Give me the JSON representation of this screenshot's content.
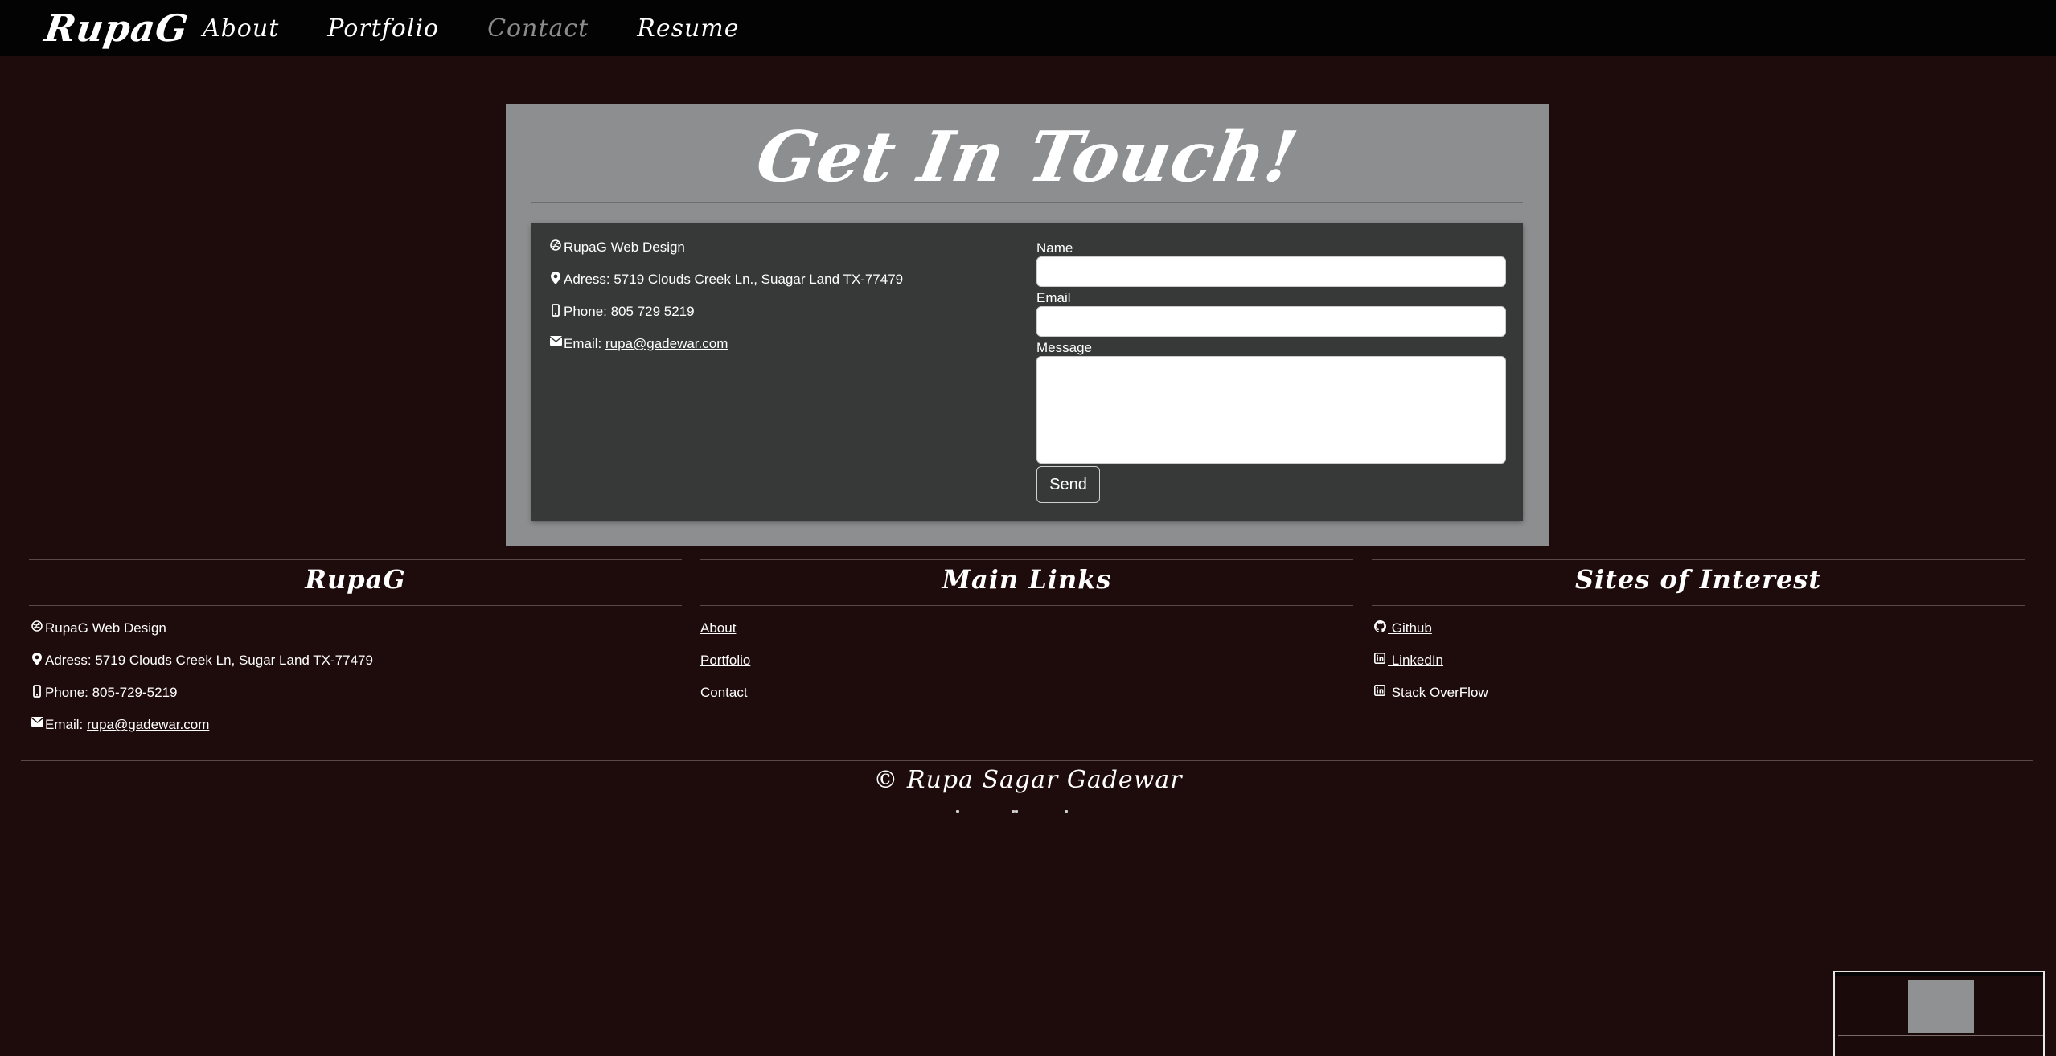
{
  "nav": {
    "brand": "RupaG",
    "links": [
      "About",
      "Portfolio",
      "Contact",
      "Resume"
    ],
    "active": "Contact"
  },
  "contact": {
    "title": "Get In Touch!",
    "info": [
      {
        "icon": "dribbble-icon",
        "text": "RupaG Web Design"
      },
      {
        "icon": "map-marker-icon",
        "text": "Adress: 5719 Clouds Creek Ln., Suagar Land TX-77479"
      },
      {
        "icon": "mobile-phone-icon",
        "text": "Phone: 805 729 5219"
      },
      {
        "icon": "envelope-icon",
        "prefix": "Email: ",
        "link": "rupa@gadewar.com"
      }
    ],
    "form": {
      "name_label": "Name",
      "email_label": "Email",
      "message_label": "Message",
      "name_value": "",
      "email_value": "",
      "message_value": "",
      "send_label": "Send"
    }
  },
  "footer": {
    "col1": {
      "title": "RupaG",
      "items": [
        {
          "icon": "dribbble-icon",
          "text": "RupaG Web Design"
        },
        {
          "icon": "map-marker-icon",
          "text": "Adress: 5719 Clouds Creek Ln, Sugar Land TX-77479"
        },
        {
          "icon": "mobile-phone-icon",
          "text": "Phone: 805-729-5219"
        },
        {
          "icon": "envelope-icon",
          "prefix": "Email: ",
          "link": "rupa@gadewar.com"
        }
      ]
    },
    "col2": {
      "title": "Main Links",
      "items": [
        "About",
        "Portfolio",
        "Contact"
      ]
    },
    "col3": {
      "title": "Sites of Interest",
      "items": [
        {
          "icon": "github-icon",
          "text": " Github"
        },
        {
          "icon": "linkedin-icon",
          "text": " LinkedIn"
        },
        {
          "icon": "linkedin-icon",
          "text": " Stack OverFlow"
        }
      ]
    },
    "copyright": "© Rupa Sagar Gadewar"
  },
  "colors": {
    "page_bg": "#1e0b0b",
    "nav_bg": "#030303",
    "panel_bg": "#8c8e8f",
    "card_bg": "#373938",
    "active_link": "#8b8b8b"
  }
}
